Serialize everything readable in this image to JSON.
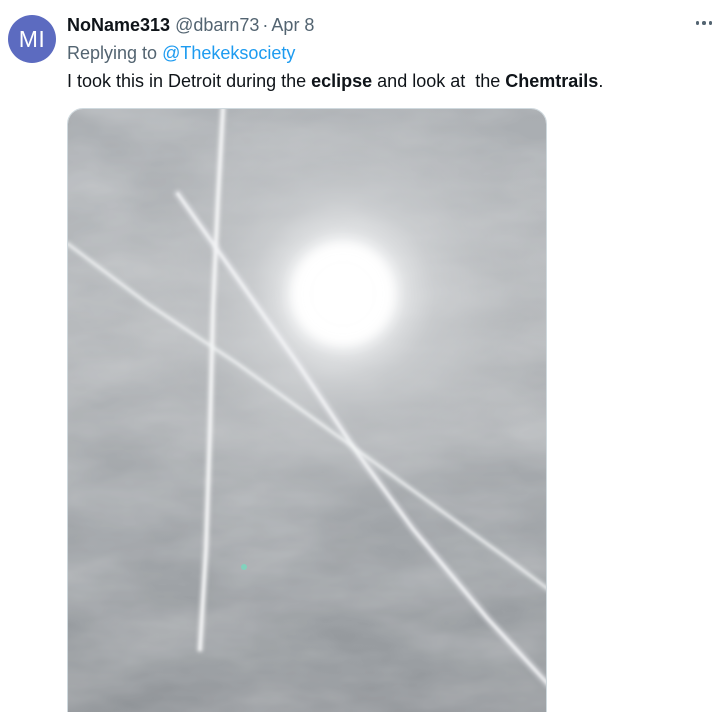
{
  "author": {
    "avatar_initials": "MI",
    "avatar_color": "#5c6bc0",
    "display_name": "NoName313",
    "handle": "@dbarn73",
    "separator": "·",
    "date": "Apr 8"
  },
  "reply": {
    "prefix": "Replying to ",
    "mention": "@Thekeksociety"
  },
  "text": {
    "part1": "I took this in Detroit during the ",
    "bold1": "eclipse",
    "part2": " and look at  the ",
    "bold2": "Chemtrails",
    "part3": "."
  },
  "icons": {
    "more": "more-horizontal-icon"
  },
  "colors": {
    "text": "#0f1419",
    "secondary": "#536471",
    "link": "#1d9bf0"
  }
}
